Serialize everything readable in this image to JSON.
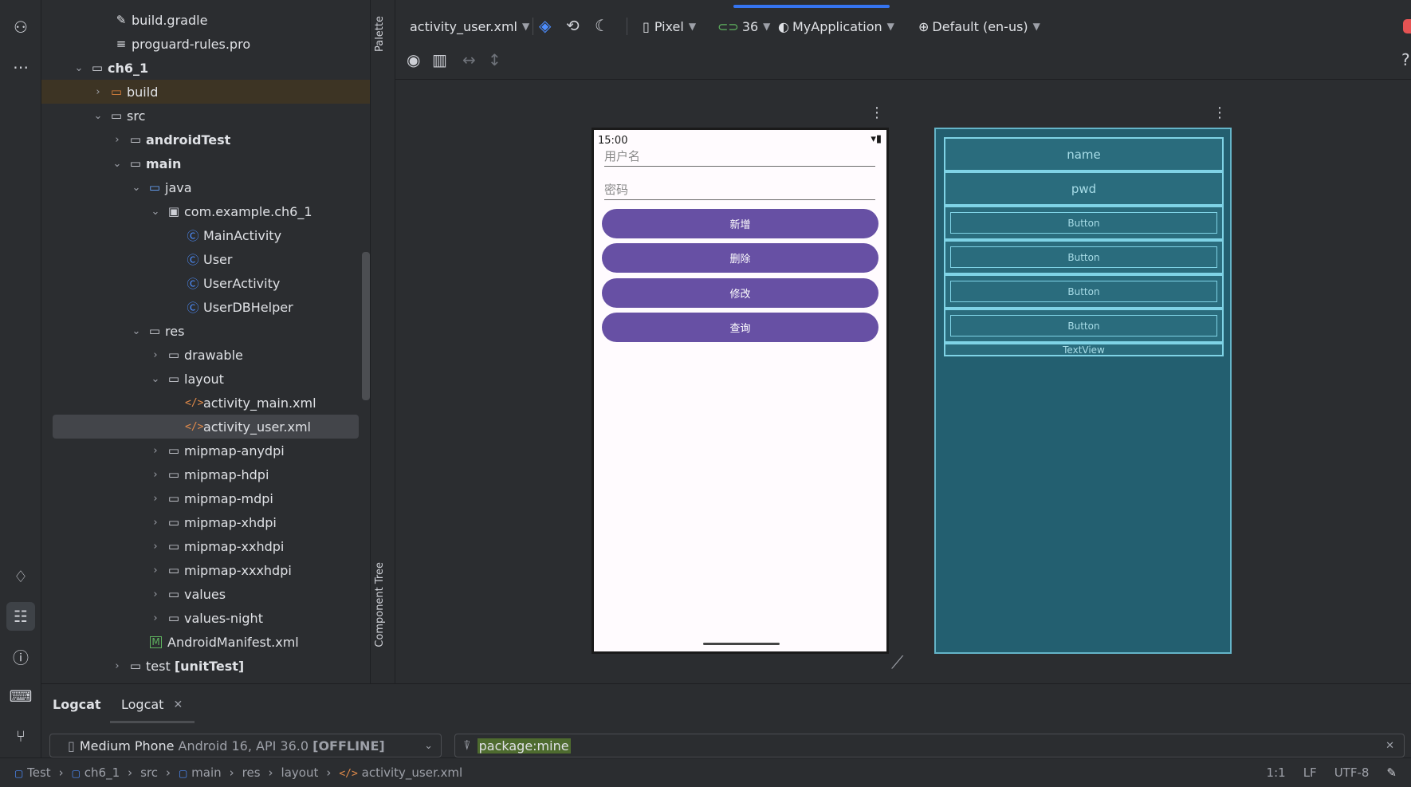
{
  "toolbar": {
    "file": "activity_user.xml",
    "device": "Pixel",
    "api": "36",
    "theme": "MyApplication",
    "locale": "Default (en-us)"
  },
  "side_labels": {
    "palette": "Palette",
    "component_tree": "Component Tree"
  },
  "tree": [
    {
      "label": "build.gradle",
      "icon": "gradle-icon"
    },
    {
      "label": "proguard-rules.pro",
      "icon": "text-file-icon"
    },
    {
      "label": "ch6_1",
      "icon": "module-icon"
    },
    {
      "label": "build",
      "icon": "folder-icon"
    },
    {
      "label": "src",
      "icon": "folder-icon"
    },
    {
      "label": "androidTest",
      "icon": "folder-icon"
    },
    {
      "label": "main",
      "icon": "folder-icon"
    },
    {
      "label": "java",
      "icon": "folder-icon"
    },
    {
      "label": "com.example.ch6_1",
      "icon": "package-icon"
    },
    {
      "label": "MainActivity",
      "icon": "class-icon"
    },
    {
      "label": "User",
      "icon": "class-icon"
    },
    {
      "label": "UserActivity",
      "icon": "class-icon"
    },
    {
      "label": "UserDBHelper",
      "icon": "class-icon"
    },
    {
      "label": "res",
      "icon": "folder-icon"
    },
    {
      "label": "drawable",
      "icon": "folder-icon"
    },
    {
      "label": "layout",
      "icon": "folder-icon"
    },
    {
      "label": "activity_main.xml",
      "icon": "xml-icon"
    },
    {
      "label": "activity_user.xml",
      "icon": "xml-icon"
    },
    {
      "label": "mipmap-anydpi",
      "icon": "folder-icon"
    },
    {
      "label": "mipmap-hdpi",
      "icon": "folder-icon"
    },
    {
      "label": "mipmap-mdpi",
      "icon": "folder-icon"
    },
    {
      "label": "mipmap-xhdpi",
      "icon": "folder-icon"
    },
    {
      "label": "mipmap-xxhdpi",
      "icon": "folder-icon"
    },
    {
      "label": "mipmap-xxxhdpi",
      "icon": "folder-icon"
    },
    {
      "label": "values",
      "icon": "folder-icon"
    },
    {
      "label": "values-night",
      "icon": "folder-icon"
    },
    {
      "label": "AndroidManifest.xml",
      "icon": "manifest-icon"
    },
    {
      "label": "test",
      "suffix": "[unitTest]",
      "icon": "folder-icon"
    }
  ],
  "phone": {
    "time": "15:00",
    "name_hint": "用户名",
    "pwd_hint": "密码",
    "buttons": [
      "新增",
      "删除",
      "修改",
      "查询"
    ]
  },
  "blueprint": {
    "name": "name",
    "pwd": "pwd",
    "buttons": [
      "Button",
      "Button",
      "Button",
      "Button"
    ],
    "textview": "TextView"
  },
  "logcat": {
    "tab1": "Logcat",
    "tab2": "Logcat",
    "device_name": "Medium Phone",
    "device_detail": "Android 16, API 36.0",
    "device_state": "[OFFLINE]",
    "filter": "package:mine"
  },
  "status": {
    "crumbs": [
      "Test",
      "ch6_1",
      "src",
      "main",
      "res",
      "layout",
      "activity_user.xml"
    ],
    "position": "1:1",
    "line_ending": "LF",
    "encoding": "UTF-8"
  },
  "colors": {
    "button_purple": "#6750a4",
    "blueprint_bg": "#235f70",
    "selection": "#43454a"
  }
}
